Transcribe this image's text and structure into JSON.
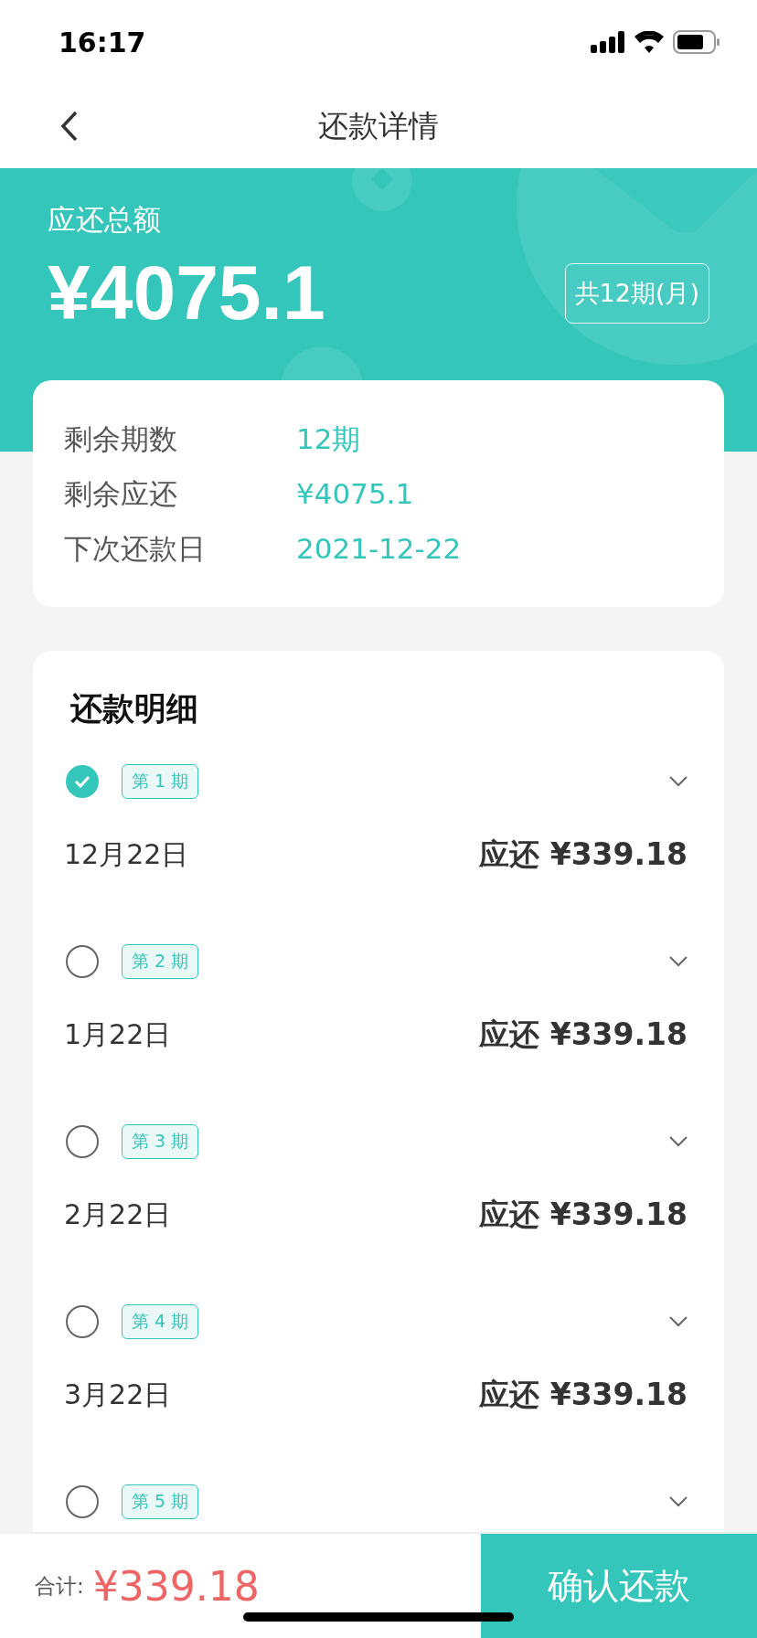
{
  "status_bar": {
    "time": "16:17"
  },
  "nav": {
    "title": "还款详情"
  },
  "header": {
    "label": "应还总额",
    "amount": "¥4075.1",
    "term_badge": "共12期(月)"
  },
  "summary": [
    {
      "label": "剩余期数",
      "value": "12期"
    },
    {
      "label": "剩余应还",
      "value": "¥4075.1"
    },
    {
      "label": "下次还款日",
      "value": "2021-12-22"
    }
  ],
  "details": {
    "title": "还款明细",
    "items": [
      {
        "tag": "第 1 期",
        "selected": true,
        "date": "12月22日",
        "amount": "应还 ¥339.18"
      },
      {
        "tag": "第 2 期",
        "selected": false,
        "date": "1月22日",
        "amount": "应还 ¥339.18"
      },
      {
        "tag": "第 3 期",
        "selected": false,
        "date": "2月22日",
        "amount": "应还 ¥339.18"
      },
      {
        "tag": "第 4 期",
        "selected": false,
        "date": "3月22日",
        "amount": "应还 ¥339.18"
      },
      {
        "tag": "第 5 期",
        "selected": false
      }
    ]
  },
  "footer": {
    "total_label": "合计:",
    "total": "¥339.18",
    "button": "确认还款"
  }
}
